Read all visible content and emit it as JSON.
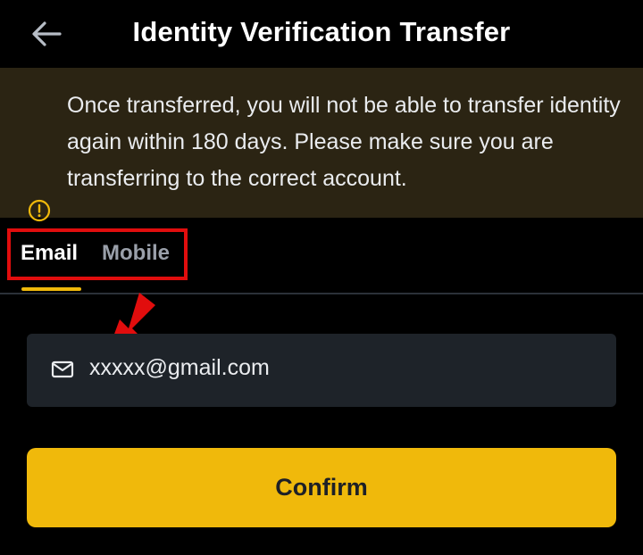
{
  "header": {
    "title": "Identity Verification Transfer",
    "back_icon": "arrow-left-icon"
  },
  "banner": {
    "icon": "alert-circle-icon",
    "message": "Once transferred, you will not be able to transfer identity again within 180 days. Please make sure you are transferring to the correct account."
  },
  "tabs": [
    {
      "label": "Email",
      "active": true
    },
    {
      "label": "Mobile",
      "active": false
    }
  ],
  "email_field": {
    "icon": "mail-icon",
    "value": "xxxxx@gmail.com"
  },
  "confirm_button": {
    "label": "Confirm"
  },
  "colors": {
    "accent": "#f0b90b",
    "banner_bg": "#2b2413",
    "field_bg": "#1e2329",
    "annotation_red": "#e10d0d"
  }
}
